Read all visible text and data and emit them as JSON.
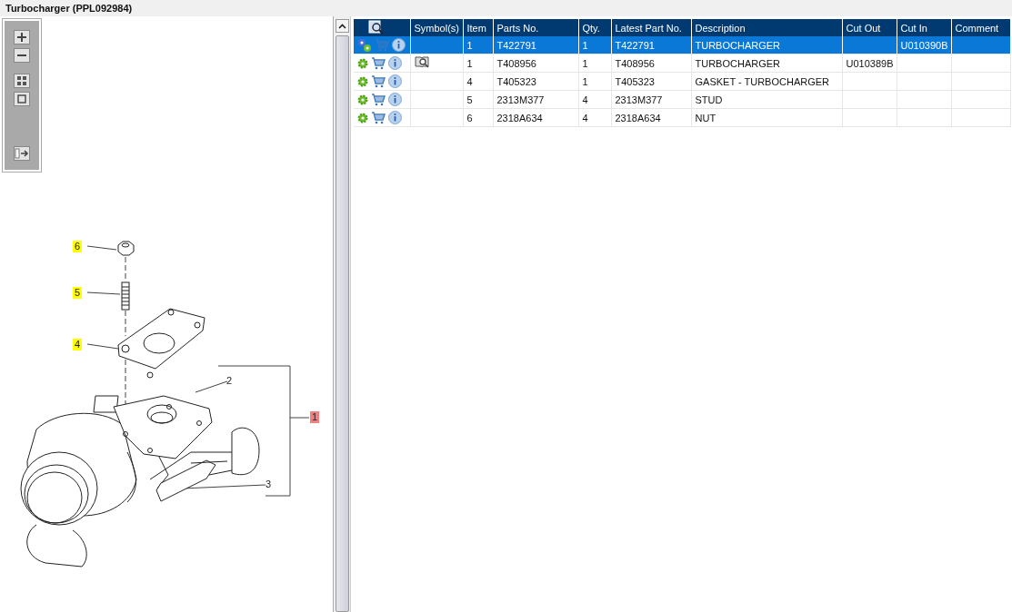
{
  "window": {
    "title": "Turbocharger (PPL092984)"
  },
  "callouts": [
    {
      "label": "6",
      "color": "#ffff00"
    },
    {
      "label": "5",
      "color": "#ffff00"
    },
    {
      "label": "4",
      "color": "#ffff00"
    },
    {
      "label": "2"
    },
    {
      "label": "1",
      "color": "#f08080"
    },
    {
      "label": "3"
    }
  ],
  "table": {
    "columns": [
      {
        "kind": "search"
      },
      {
        "kind": "text",
        "label": "Symbol(s)"
      },
      {
        "kind": "text",
        "label": "Item"
      },
      {
        "kind": "text",
        "label": "Parts No."
      },
      {
        "kind": "text",
        "label": "Qty."
      },
      {
        "kind": "text",
        "label": "Latest Part No."
      },
      {
        "kind": "text",
        "label": "Description"
      },
      {
        "kind": "text",
        "label": "Cut Out"
      },
      {
        "kind": "text",
        "label": "Cut In"
      },
      {
        "kind": "text",
        "label": "Comment"
      }
    ],
    "rows": [
      {
        "selected": true,
        "kind": "assembly",
        "symbol": false,
        "cells": [
          "",
          "",
          "1",
          "T422791",
          "1",
          "T422791",
          "TURBOCHARGER",
          "",
          "U010390B",
          ""
        ]
      },
      {
        "selected": false,
        "kind": "part",
        "symbol": true,
        "cells": [
          "",
          "",
          "1",
          "T408956",
          "1",
          "T408956",
          "TURBOCHARGER",
          "U010389B",
          "",
          ""
        ]
      },
      {
        "selected": false,
        "kind": "part",
        "symbol": false,
        "cells": [
          "",
          "",
          "4",
          "T405323",
          "1",
          "T405323",
          "GASKET - TURBOCHARGER",
          "",
          "",
          ""
        ]
      },
      {
        "selected": false,
        "kind": "part",
        "symbol": false,
        "cells": [
          "",
          "",
          "5",
          "2313M377",
          "4",
          "2313M377",
          "STUD",
          "",
          "",
          ""
        ]
      },
      {
        "selected": false,
        "kind": "part",
        "symbol": false,
        "cells": [
          "",
          "",
          "6",
          "2318A634",
          "4",
          "2318A634",
          "NUT",
          "",
          "",
          ""
        ]
      }
    ]
  }
}
